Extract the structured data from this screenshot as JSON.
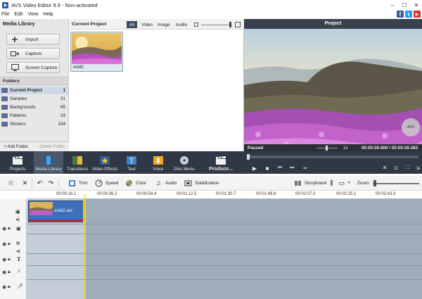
{
  "window": {
    "title": "AVS Video Editor 9.9 - Non-activated",
    "controls": [
      "minimize",
      "maximize",
      "close"
    ]
  },
  "menu": [
    "File",
    "Edit",
    "View",
    "Help"
  ],
  "social": [
    "f",
    "t",
    "▶"
  ],
  "library": {
    "title": "Media Library",
    "buttons": [
      {
        "label": "Import",
        "icon": "plus-icon"
      },
      {
        "label": "Capture",
        "icon": "camera-icon"
      },
      {
        "label": "Screen Capture",
        "icon": "monitor-icon"
      }
    ],
    "folders_title": "Folders",
    "folders": [
      {
        "name": "Current Project",
        "count": "1",
        "selected": true
      },
      {
        "name": "Samples",
        "count": "31"
      },
      {
        "name": "Backgrounds",
        "count": "65"
      },
      {
        "name": "Patterns",
        "count": "33"
      },
      {
        "name": "Stickers",
        "count": "234"
      }
    ],
    "add_folder": "+ Add Folder",
    "delete_folder": "− Delete Folder"
  },
  "project": {
    "title": "Current Project",
    "filters": [
      "All",
      "Video",
      "Image",
      "Audio"
    ],
    "active_filter": "All",
    "items": [
      {
        "name": "xvid2"
      }
    ]
  },
  "preview": {
    "title": "Project",
    "status": "Paused",
    "speed": "1x",
    "time": "00:00:00.000 / 00:00:26.383",
    "watermark": "AVS"
  },
  "main_toolbar": [
    {
      "label": "Projects"
    },
    {
      "label": "Media Library",
      "active": true
    },
    {
      "label": "Transitions"
    },
    {
      "label": "Video Effects"
    },
    {
      "label": "Text"
    },
    {
      "label": "Voice"
    },
    {
      "label": "Disc Menu"
    },
    {
      "label": "Produce..."
    }
  ],
  "edit_toolbar": {
    "trim": "Trim",
    "speed": "Speed",
    "color": "Color",
    "audio": "Audio",
    "stabilization": "Stabilization",
    "storyboard": "Storyboard",
    "zoom": "Zoom:"
  },
  "timeline": {
    "ticks": [
      "00:00:18.1",
      "00:00:36.2",
      "00:00:54.4",
      "00:01:12.5",
      "00:01:30.7",
      "00:01:48.8",
      "00:02:07.0",
      "00:02:25.1",
      "00:02:43.3"
    ],
    "clip_name": "xvid2.avi"
  },
  "colors": {
    "toolbar_bg": "#2f3844",
    "clip_blue": "#3f6fb8",
    "playhead": "#f1c40f",
    "track_bg": "#9fadbb"
  }
}
